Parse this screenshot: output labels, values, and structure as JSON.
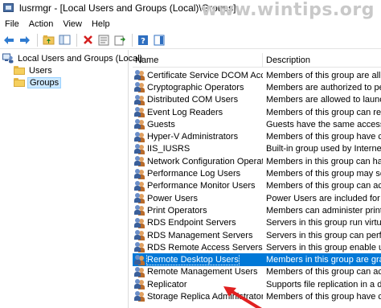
{
  "window": {
    "title": "lusrmgr - [Local Users and Groups (Local)\\Groups]",
    "watermark": "www.wintips.org"
  },
  "menu": [
    "File",
    "Action",
    "View",
    "Help"
  ],
  "toolbar": {
    "buttons": [
      "back-arrow-icon",
      "forward-arrow-icon",
      "up-folder-icon",
      "show-tree-icon",
      "delete-icon",
      "properties-icon",
      "export-icon",
      "help-icon",
      "action-pane-icon"
    ]
  },
  "tree": {
    "root": "Local Users and Groups (Local)",
    "children": [
      "Users",
      "Groups"
    ],
    "selected": "Groups"
  },
  "list": {
    "columns": {
      "name": "Name",
      "description": "Description"
    },
    "rows": [
      {
        "name": "Certificate Service DCOM Access",
        "description": "Members of this group are allow"
      },
      {
        "name": "Cryptographic Operators",
        "description": "Members are authorized to perfo"
      },
      {
        "name": "Distributed COM Users",
        "description": "Members are allowed to launch,"
      },
      {
        "name": "Event Log Readers",
        "description": "Members of this group can read"
      },
      {
        "name": "Guests",
        "description": "Guests have the same access as"
      },
      {
        "name": "Hyper-V Administrators",
        "description": "Members of this group have co"
      },
      {
        "name": "IIS_IUSRS",
        "description": "Built-in group used by Internet I"
      },
      {
        "name": "Network Configuration Operat...",
        "description": "Members in this group can have"
      },
      {
        "name": "Performance Log Users",
        "description": "Members of this group may sche"
      },
      {
        "name": "Performance Monitor Users",
        "description": "Members of this group can acce"
      },
      {
        "name": "Power Users",
        "description": "Power Users are included for bac"
      },
      {
        "name": "Print Operators",
        "description": "Members can administer printer"
      },
      {
        "name": "RDS Endpoint Servers",
        "description": "Servers in this group run virtual r"
      },
      {
        "name": "RDS Management Servers",
        "description": "Servers in this group can perfo"
      },
      {
        "name": "RDS Remote Access Servers",
        "description": "Servers in this group enable user"
      },
      {
        "name": "Remote Desktop Users",
        "description": "Members in this group are grante",
        "selected": true
      },
      {
        "name": "Remote Management Users",
        "description": "Members of this group can acce"
      },
      {
        "name": "Replicator",
        "description": "Supports file replication in a dom"
      },
      {
        "name": "Storage Replica Administrators",
        "description": "Members of this group have co"
      }
    ]
  },
  "colors": {
    "selection": "#0078d7",
    "arrow": "#e02020"
  }
}
